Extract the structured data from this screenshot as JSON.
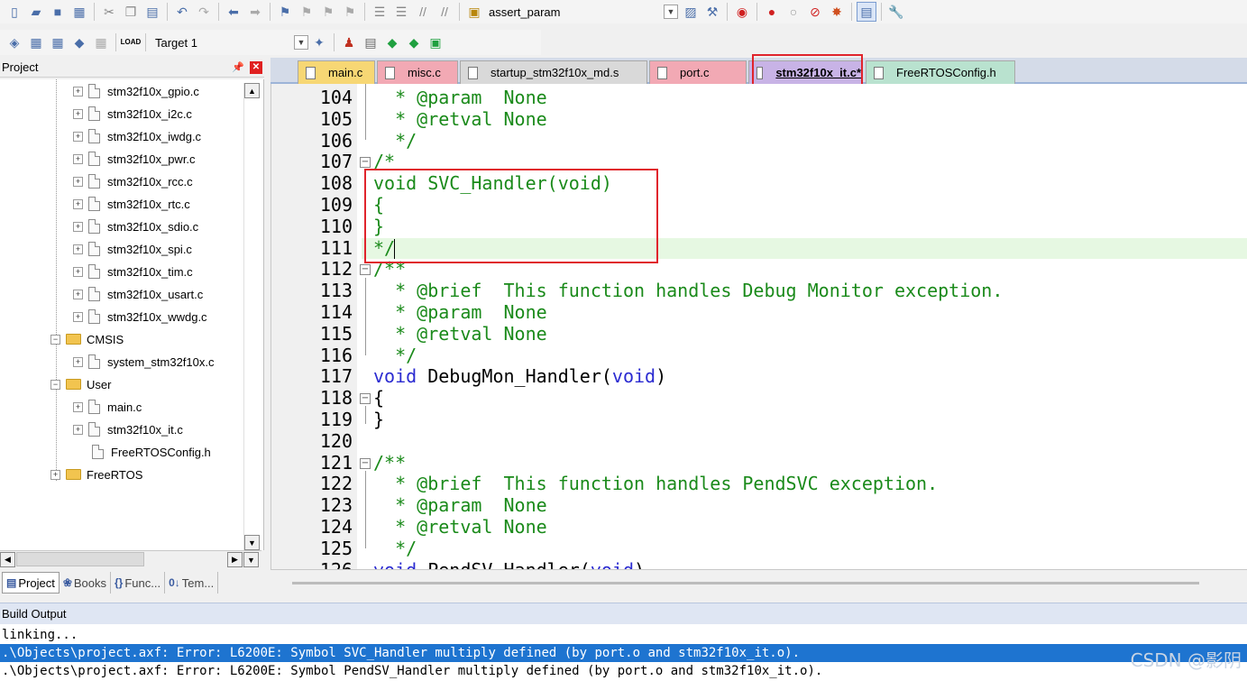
{
  "toolbar": {
    "find_text": "assert_param",
    "target": "Target 1",
    "load_label": "LOAD"
  },
  "project_panel": {
    "title": "Project",
    "tree": [
      {
        "label": "stm32f10x_gpio.c",
        "kind": "file"
      },
      {
        "label": "stm32f10x_i2c.c",
        "kind": "file"
      },
      {
        "label": "stm32f10x_iwdg.c",
        "kind": "file"
      },
      {
        "label": "stm32f10x_pwr.c",
        "kind": "file"
      },
      {
        "label": "stm32f10x_rcc.c",
        "kind": "file"
      },
      {
        "label": "stm32f10x_rtc.c",
        "kind": "file"
      },
      {
        "label": "stm32f10x_sdio.c",
        "kind": "file"
      },
      {
        "label": "stm32f10x_spi.c",
        "kind": "file"
      },
      {
        "label": "stm32f10x_tim.c",
        "kind": "file"
      },
      {
        "label": "stm32f10x_usart.c",
        "kind": "file"
      },
      {
        "label": "stm32f10x_wwdg.c",
        "kind": "file"
      },
      {
        "label": "CMSIS",
        "kind": "folder",
        "expanded": true
      },
      {
        "label": "system_stm32f10x.c",
        "kind": "file"
      },
      {
        "label": "User",
        "kind": "folder",
        "expanded": true
      },
      {
        "label": "main.c",
        "kind": "file"
      },
      {
        "label": "stm32f10x_it.c",
        "kind": "file"
      },
      {
        "label": "FreeRTOSConfig.h",
        "kind": "file"
      },
      {
        "label": "FreeRTOS",
        "kind": "folder",
        "expanded": false
      }
    ],
    "tabs": [
      {
        "label": "Project",
        "icon": "project-icon",
        "active": true
      },
      {
        "label": "Books",
        "icon": "books-icon"
      },
      {
        "label": "Func...",
        "icon": "braces-icon"
      },
      {
        "label": "Tem...",
        "icon": "template-icon"
      }
    ]
  },
  "editor": {
    "tabs": [
      {
        "label": "main.c",
        "color": "#f7d774"
      },
      {
        "label": "misc.c",
        "color": "#f2a9b4"
      },
      {
        "label": "startup_stm32f10x_md.s",
        "color": "#d9d9d9"
      },
      {
        "label": "port.c",
        "color": "#f2a9b4"
      },
      {
        "label": "stm32f10x_it.c*",
        "color": "#c8b3e6",
        "active": true
      },
      {
        "label": "FreeRTOSConfig.h",
        "color": "#b9e2cf"
      }
    ],
    "lines": [
      {
        "num": "104",
        "segments": [
          {
            "t": "  * @param  None",
            "c": "cm"
          }
        ]
      },
      {
        "num": "105",
        "segments": [
          {
            "t": "  * @retval None",
            "c": "cm"
          }
        ]
      },
      {
        "num": "106",
        "segments": [
          {
            "t": "  */",
            "c": "cm"
          }
        ]
      },
      {
        "num": "107",
        "fold": "minus",
        "segments": [
          {
            "t": "/*",
            "c": "cm"
          }
        ]
      },
      {
        "num": "108",
        "segments": [
          {
            "t": "void SVC_Handler(void)",
            "c": "cm"
          }
        ]
      },
      {
        "num": "109",
        "segments": [
          {
            "t": "{",
            "c": "cm"
          }
        ]
      },
      {
        "num": "110",
        "segments": [
          {
            "t": "}",
            "c": "cm"
          }
        ]
      },
      {
        "num": "111",
        "highlight": true,
        "segments": [
          {
            "t": "*/",
            "c": "cm"
          }
        ]
      },
      {
        "num": "112",
        "fold": "minus",
        "segments": [
          {
            "t": "/**",
            "c": "cm"
          }
        ]
      },
      {
        "num": "113",
        "segments": [
          {
            "t": "  * @brief  This function handles Debug Monitor exception.",
            "c": "cm"
          }
        ]
      },
      {
        "num": "114",
        "segments": [
          {
            "t": "  * @param  None",
            "c": "cm"
          }
        ]
      },
      {
        "num": "115",
        "segments": [
          {
            "t": "  * @retval None",
            "c": "cm"
          }
        ]
      },
      {
        "num": "116",
        "segments": [
          {
            "t": "  */",
            "c": "cm"
          }
        ]
      },
      {
        "num": "117",
        "segments": [
          {
            "t": "void",
            "c": "kw"
          },
          {
            "t": " DebugMon_Handler(",
            "c": "tx"
          },
          {
            "t": "void",
            "c": "kw"
          },
          {
            "t": ")",
            "c": "tx"
          }
        ]
      },
      {
        "num": "118",
        "fold": "minus",
        "segments": [
          {
            "t": "{",
            "c": "tx"
          }
        ]
      },
      {
        "num": "119",
        "segments": [
          {
            "t": "}",
            "c": "tx"
          }
        ]
      },
      {
        "num": "120",
        "segments": []
      },
      {
        "num": "121",
        "fold": "minus",
        "segments": [
          {
            "t": "/**",
            "c": "cm"
          }
        ]
      },
      {
        "num": "122",
        "segments": [
          {
            "t": "  * @brief  This function handles PendSVC exception.",
            "c": "cm"
          }
        ]
      },
      {
        "num": "123",
        "segments": [
          {
            "t": "  * @param  None",
            "c": "cm"
          }
        ]
      },
      {
        "num": "124",
        "segments": [
          {
            "t": "  * @retval None",
            "c": "cm"
          }
        ]
      },
      {
        "num": "125",
        "segments": [
          {
            "t": "  */",
            "c": "cm"
          }
        ]
      },
      {
        "num": "126",
        "segments": [
          {
            "t": "void",
            "c": "kw"
          },
          {
            "t": " PendSV_Handler(",
            "c": "tx"
          },
          {
            "t": "void",
            "c": "kw"
          },
          {
            "t": ")",
            "c": "tx"
          }
        ]
      }
    ]
  },
  "build": {
    "title": "Build Output",
    "lines": [
      {
        "text": "linking...",
        "selected": false
      },
      {
        "text": ".\\Objects\\project.axf: Error: L6200E: Symbol SVC_Handler multiply defined (by port.o and stm32f10x_it.o).",
        "selected": true
      },
      {
        "text": ".\\Objects\\project.axf: Error: L6200E: Symbol PendSV_Handler multiply defined (by port.o and stm32f10x_it.o).",
        "selected": false
      }
    ],
    "watermark": "CSDN @影阴"
  }
}
